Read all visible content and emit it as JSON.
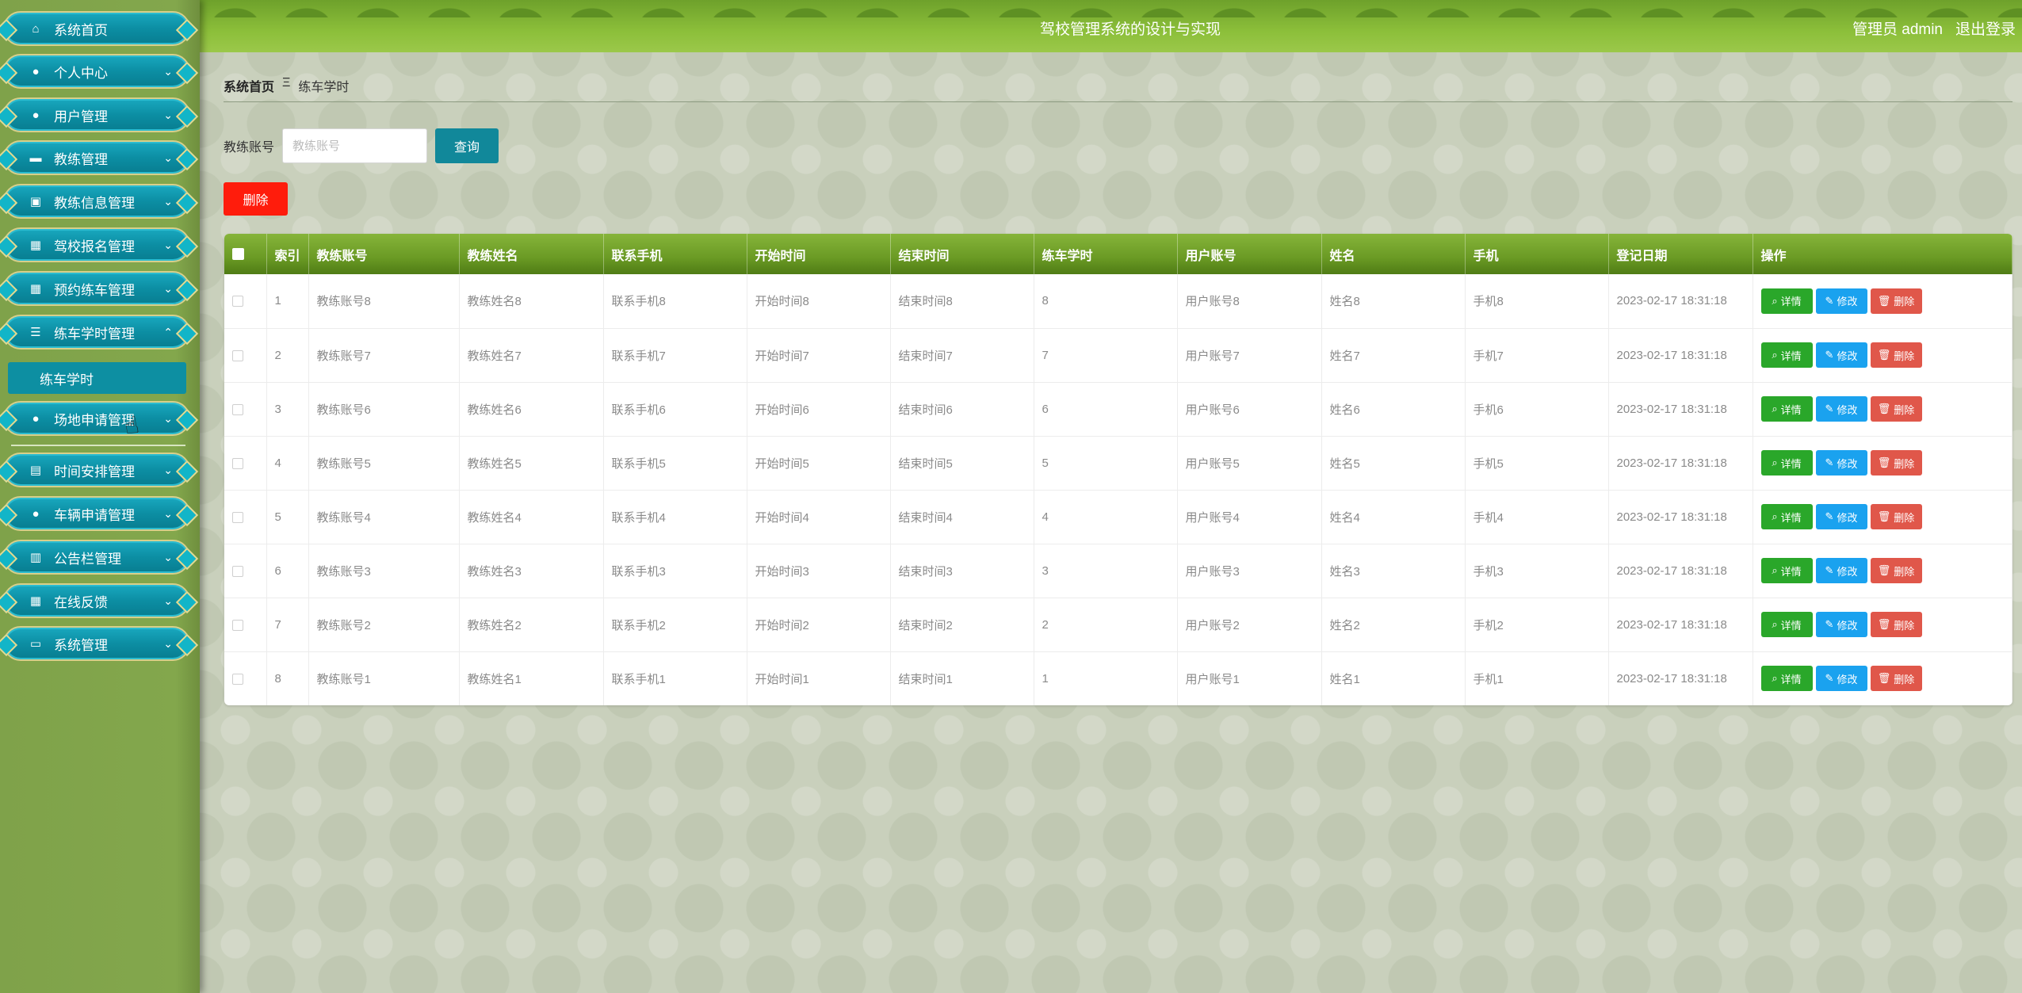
{
  "header": {
    "title": "驾校管理系统的设计与实现",
    "user": "管理员 admin",
    "logout": "退出登录"
  },
  "sidebar": {
    "items": [
      {
        "label": "系统首页",
        "icon": "home-icon"
      },
      {
        "label": "个人中心",
        "icon": "person-icon"
      },
      {
        "label": "用户管理",
        "icon": "user-icon"
      },
      {
        "label": "教练管理",
        "icon": "chat-icon"
      },
      {
        "label": "教练信息管理",
        "icon": "briefcase-icon"
      },
      {
        "label": "驾校报名管理",
        "icon": "grid-icon"
      },
      {
        "label": "预约练车管理",
        "icon": "grid-icon"
      },
      {
        "label": "练车学时管理",
        "icon": "list-icon"
      },
      {
        "label": "场地申请管理",
        "icon": "person-icon"
      },
      {
        "label": "时间安排管理",
        "icon": "calendar-icon"
      },
      {
        "label": "车辆申请管理",
        "icon": "person-icon"
      },
      {
        "label": "公告栏管理",
        "icon": "clipboard-icon"
      },
      {
        "label": "在线反馈",
        "icon": "grid-icon"
      },
      {
        "label": "系统管理",
        "icon": "monitor-icon"
      }
    ],
    "submenu": {
      "label": "练车学时"
    }
  },
  "breadcrumb": {
    "home": "系统首页",
    "separator": "Ξ",
    "current": "练车学时"
  },
  "search": {
    "label": "教练账号",
    "placeholder": "教练账号",
    "button": "查询"
  },
  "actions": {
    "delete": "删除"
  },
  "table": {
    "headers": [
      "索引",
      "教练账号",
      "教练姓名",
      "联系手机",
      "开始时间",
      "结束时间",
      "练车学时",
      "用户账号",
      "姓名",
      "手机",
      "登记日期",
      "操作"
    ],
    "ops": {
      "detail": "详情",
      "edit": "修改",
      "delete": "删除"
    },
    "rows": [
      [
        "1",
        "教练账号8",
        "教练姓名8",
        "联系手机8",
        "开始时间8",
        "结束时间8",
        "8",
        "用户账号8",
        "姓名8",
        "手机8",
        "2023-02-17 18:31:18"
      ],
      [
        "2",
        "教练账号7",
        "教练姓名7",
        "联系手机7",
        "开始时间7",
        "结束时间7",
        "7",
        "用户账号7",
        "姓名7",
        "手机7",
        "2023-02-17 18:31:18"
      ],
      [
        "3",
        "教练账号6",
        "教练姓名6",
        "联系手机6",
        "开始时间6",
        "结束时间6",
        "6",
        "用户账号6",
        "姓名6",
        "手机6",
        "2023-02-17 18:31:18"
      ],
      [
        "4",
        "教练账号5",
        "教练姓名5",
        "联系手机5",
        "开始时间5",
        "结束时间5",
        "5",
        "用户账号5",
        "姓名5",
        "手机5",
        "2023-02-17 18:31:18"
      ],
      [
        "5",
        "教练账号4",
        "教练姓名4",
        "联系手机4",
        "开始时间4",
        "结束时间4",
        "4",
        "用户账号4",
        "姓名4",
        "手机4",
        "2023-02-17 18:31:18"
      ],
      [
        "6",
        "教练账号3",
        "教练姓名3",
        "联系手机3",
        "开始时间3",
        "结束时间3",
        "3",
        "用户账号3",
        "姓名3",
        "手机3",
        "2023-02-17 18:31:18"
      ],
      [
        "7",
        "教练账号2",
        "教练姓名2",
        "联系手机2",
        "开始时间2",
        "结束时间2",
        "2",
        "用户账号2",
        "姓名2",
        "手机2",
        "2023-02-17 18:31:18"
      ],
      [
        "8",
        "教练账号1",
        "教练姓名1",
        "联系手机1",
        "开始时间1",
        "结束时间1",
        "1",
        "用户账号1",
        "姓名1",
        "手机1",
        "2023-02-17 18:31:18"
      ]
    ]
  },
  "colors": {
    "sidebar_bg": "#83a74c",
    "menu_teal": "#0c8ea3",
    "header_green": "#8cbf3a",
    "query_btn": "#11889a",
    "delete_btn": "#ff1c0c",
    "detail_btn": "#2aa72a",
    "edit_btn": "#1aa2ef",
    "row_delete_btn": "#e0574a"
  }
}
